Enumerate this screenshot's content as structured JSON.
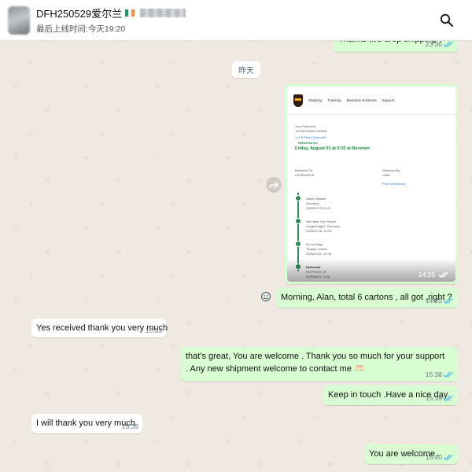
{
  "header": {
    "contact_name": "DFH250529爱尔兰",
    "last_seen": "最后上线时间:今天19:20",
    "flag_icon": "ireland-flag-icon",
    "search_icon": "search-icon"
  },
  "chat": {
    "day_divider": "昨天",
    "messages": [
      {
        "id": "m0",
        "dir": "out",
        "text": "Thanks ,it's drop shipping ?",
        "time": "23:36",
        "read": true
      },
      {
        "id": "m1",
        "dir": "out",
        "type": "image",
        "time": "14:25",
        "read": true
      },
      {
        "id": "m2",
        "dir": "out",
        "text": "Morning, Alan, total 6 cartons , all got ,right ?",
        "time": "14:25",
        "read": true
      },
      {
        "id": "m3",
        "dir": "in",
        "text": "Yes received thank you very much",
        "time": "15:33"
      },
      {
        "id": "m4",
        "dir": "out",
        "text": "that's great, You are welcome . Thank you so much for your support .   Any new shipment welcome to contact me 🫶🏻",
        "time": "15:38",
        "read": true
      },
      {
        "id": "m5",
        "dir": "out",
        "text": "Keep in touch .Have a nice day",
        "time": "15:39",
        "read": true
      },
      {
        "id": "m6",
        "dir": "in",
        "text": "I will thank you very much",
        "time": "15:39"
      },
      {
        "id": "m7",
        "dir": "out",
        "text": "You are welcome .",
        "time": "15:40",
        "read": true
      }
    ]
  },
  "ups_screenshot": {
    "nav": [
      "Shipping",
      "Tracking",
      "Business Solutions",
      "Support"
    ],
    "your_shipment": "Your Shipment",
    "tracking_number": "1Z4780Y84817184090",
    "pieces": "1 of 6 Piece Shipment",
    "delivered_on_label": "Delivered On",
    "delivered_on": "Friday, August 01 at 9:33 at Receiver",
    "delivered_to_label": "Delivered To",
    "delivered_to": "KILPEDER IE",
    "received_by_label": "Received By",
    "received_by": "LIAM",
    "proof_of_delivery": "Proof of Delivery",
    "milestones": [
      {
        "label": "Label Created",
        "place": "Germany",
        "date": "2025/07/15 20:47"
      },
      {
        "label": "We Have Your Parcel",
        "place": "Langenhagen, Germany",
        "date": "2025/07/28, 12:16"
      },
      {
        "label": "On the Way",
        "place": "Tinglas, Ireland",
        "date": "2025/07/31, 10:39"
      },
      {
        "label": "Delivered",
        "place": "KILPEDER, IE",
        "date": "2025/08/01, 9:33"
      }
    ]
  },
  "icons": {
    "forward": "forward-icon",
    "emoji": "emoji-icon",
    "read_ticks": "double-check-icon"
  },
  "colors": {
    "outgoing_bubble": "#d9fdd3",
    "incoming_bubble": "#ffffff",
    "read_tick": "#53bdeb",
    "ups_green": "#138a34"
  }
}
